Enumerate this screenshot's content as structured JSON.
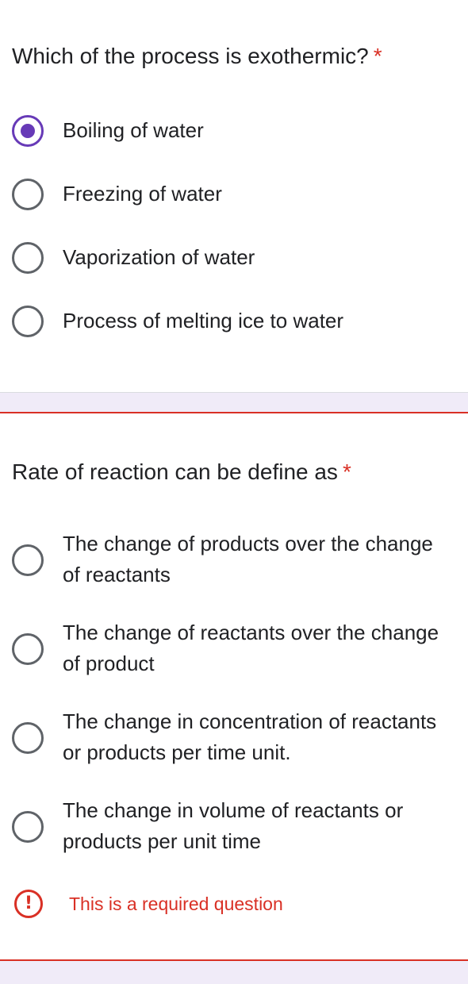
{
  "questions": [
    {
      "title": "Which of the process is exothermic?",
      "required_marker": "*",
      "options": [
        {
          "label": "Boiling of water",
          "selected": true
        },
        {
          "label": "Freezing of water",
          "selected": false
        },
        {
          "label": "Vaporization of water",
          "selected": false
        },
        {
          "label": "Process of melting ice to water",
          "selected": false
        }
      ]
    },
    {
      "title": "Rate of reaction can be define as",
      "required_marker": "*",
      "options": [
        {
          "label": "The change of products over the change of reactants",
          "selected": false
        },
        {
          "label": "The change of reactants over the change of product",
          "selected": false
        },
        {
          "label": "The change in concentration of reactants or products per time unit.",
          "selected": false
        },
        {
          "label": "The change in volume of reactants or products per unit time",
          "selected": false
        }
      ],
      "error": {
        "icon": "exclamation-icon",
        "symbol": "!",
        "text": "This is a required question"
      }
    }
  ],
  "colors": {
    "accent": "#673ab7",
    "error": "#d93025",
    "text": "#202124",
    "radio_border": "#5f6368",
    "background_separator": "#f0ebf8"
  }
}
